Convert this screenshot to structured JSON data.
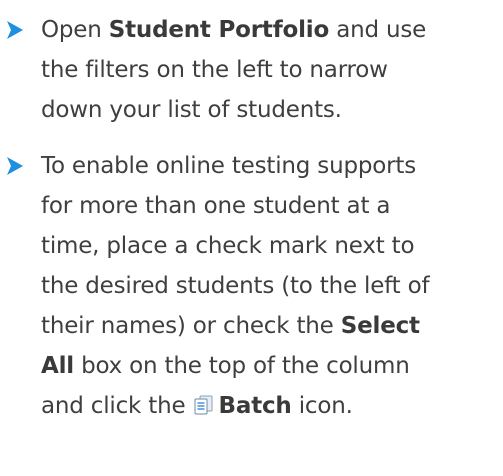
{
  "colors": {
    "bullet": "#1f8fe0",
    "text": "#3f3f3f"
  },
  "items": [
    {
      "icon": "chevron-right-icon",
      "lines": [
        {
          "pre": "Open ",
          "bold": "Student Portfolio",
          "post": " and use"
        },
        {
          "text": "the filters on the left to narrow"
        },
        {
          "text": "down your list of students."
        }
      ]
    },
    {
      "icon": "chevron-right-icon",
      "lines": [
        {
          "text": "To enable online testing supports"
        },
        {
          "text": "for more than one student at a"
        },
        {
          "text": "time, place a check mark next to"
        },
        {
          "text": "the desired students (to the left of"
        },
        {
          "pre": "their names) or check the ",
          "bold": "Select"
        },
        {
          "bold": "All",
          "post": " box on the top of the column"
        },
        {
          "pre": "and click the ",
          "icon": "batch-icon",
          "bold": "Batch",
          "post": " icon."
        }
      ]
    }
  ]
}
